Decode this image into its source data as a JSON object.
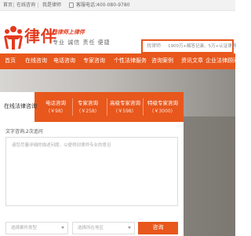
{
  "topbar": {
    "home": "首页",
    "login": "在线咨询",
    "register": "我是律师",
    "phone_label": "客服电话：",
    "phone": "400-080-9780"
  },
  "header": {
    "brand": "律伴",
    "slogan": "找律师上律伴",
    "motto": "专业 诚信 责任 便捷"
  },
  "search": {
    "placeholder": "找律师",
    "stats": "1900万+解答记录、5万+认证律师"
  },
  "nav": {
    "items": [
      "首页",
      "在线咨询",
      "电话咨询",
      "专家咨询",
      "个性法律服务",
      "咨询案例",
      "资讯文章",
      "企业法律顾问"
    ]
  },
  "consult": {
    "tabs": [
      {
        "name": "在线法律咨询",
        "price": ""
      },
      {
        "name": "电话咨询",
        "price": "(￥98)"
      },
      {
        "name": "专家咨询",
        "price": "(￥258)"
      },
      {
        "name": "高级专家咨询",
        "price": "(￥598)"
      },
      {
        "name": "特级专家咨询",
        "price": "(￥3000)"
      }
    ],
    "label": "文字咨询,2次追问",
    "placeholder": "请您尽量详细的描述问题，以便得到律师专业的意见",
    "case_type": "选择案件类型",
    "region": "选择所在地区",
    "submit": "咨询"
  },
  "colors": {
    "accent": "#e8571c",
    "brand_red": "#e43a1e"
  }
}
